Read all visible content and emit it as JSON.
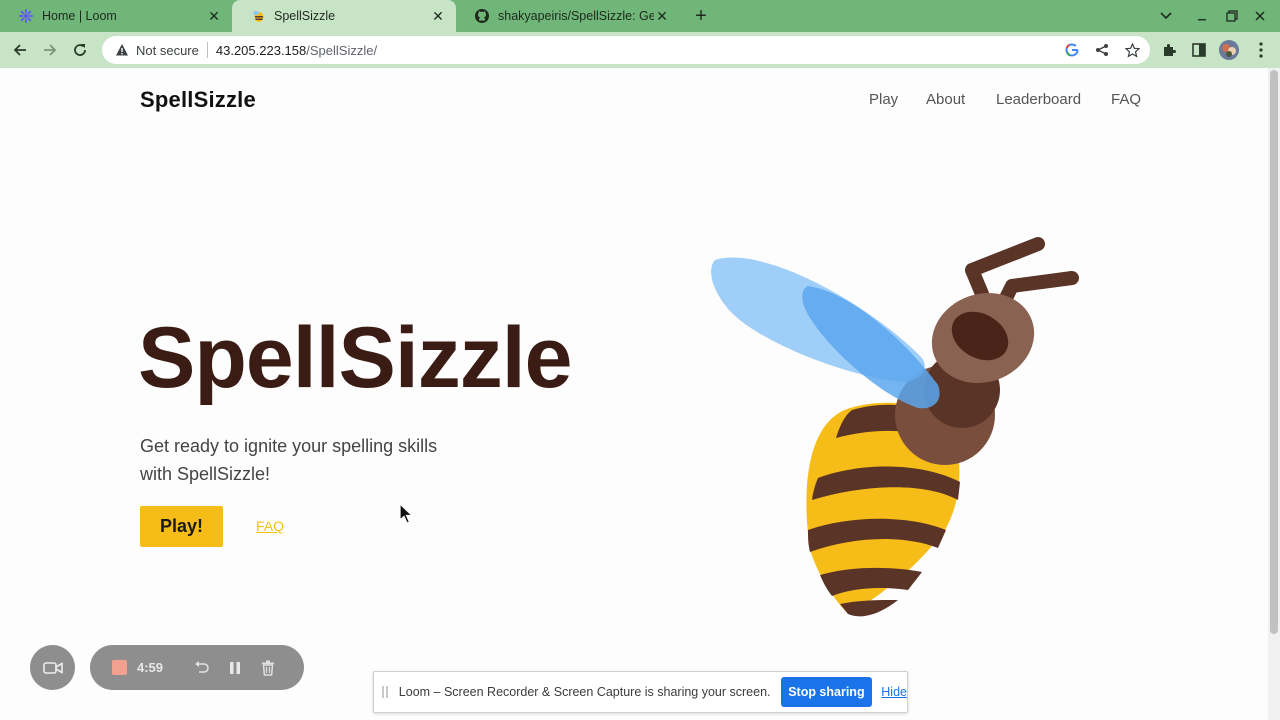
{
  "browser": {
    "tabs": [
      {
        "title": "Home | Loom",
        "favicon": "loom-icon"
      },
      {
        "title": "SpellSizzle",
        "favicon": "bee-icon",
        "active": true
      },
      {
        "title": "shakyapeiris/SpellSizzle: Get",
        "favicon": "github-icon"
      }
    ],
    "new_tab": "+",
    "address": {
      "security": "Not secure",
      "host": "43.205.223.158",
      "path": "/SpellSizzle/"
    }
  },
  "site": {
    "brand": "SpellSizzle",
    "nav": [
      "Play",
      "About",
      "Leaderboard",
      "FAQ"
    ],
    "hero": {
      "title": "SpellSizzle",
      "subtitle": "Get ready to ignite your spelling skills with SpellSizzle!",
      "play_button": "Play!",
      "faq_link": "FAQ"
    }
  },
  "loom": {
    "timer": "4:59",
    "share_message": "Loom – Screen Recorder & Screen Capture is sharing your screen.",
    "stop_sharing": "Stop sharing",
    "hide": "Hide"
  },
  "colors": {
    "tab_strip": "#6fb678",
    "toolbar": "#c7e5c6",
    "hero_title": "#3a1c14",
    "accent_yellow": "#f6bc17",
    "loom_blue": "#1a73e8"
  }
}
